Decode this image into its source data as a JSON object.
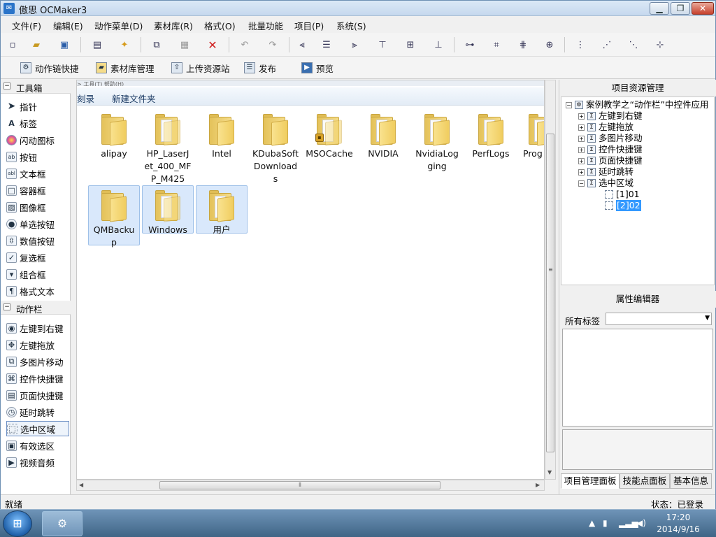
{
  "window": {
    "title": "傲思 OCMaker3",
    "min_label": "▁",
    "max_label": "❐",
    "close_label": "✕"
  },
  "menu": [
    "文件(F)",
    "编辑(E)",
    "动作菜单(D)",
    "素材库(R)",
    "格式(O)",
    "批量功能",
    "项目(P)",
    "系统(S)"
  ],
  "toolbar2": [
    "动作链快捷",
    "素材库管理",
    "上传资源站",
    "发布",
    "预览"
  ],
  "left": {
    "cat_tools": "工具箱",
    "tools": [
      "指针",
      "标签",
      "闪动图标",
      "按钮",
      "文本框",
      "容器框",
      "图像框",
      "单选按钮",
      "数值按钮",
      "复选框",
      "组合框",
      "格式文本"
    ],
    "cat_actions": "动作栏",
    "actions": [
      "左键到右键",
      "左键拖放",
      "多图片移动",
      "控件快捷键",
      "页面快捷键",
      "延时跳转",
      "选中区域",
      "有效选区",
      "视频音频"
    ]
  },
  "center": {
    "top_strip": "> 工具(T)    帮助(H)",
    "addr_burn": "刻录",
    "addr_newfolder": "新建文件夹",
    "folders": [
      {
        "name": "alipay"
      },
      {
        "name": "HP_LaserJet_400_MFP_M425"
      },
      {
        "name": "Intel"
      },
      {
        "name": "KDubaSoftDownloads"
      },
      {
        "name": "MSOCache"
      },
      {
        "name": "NVIDIA"
      },
      {
        "name": "NvidiaLogging"
      },
      {
        "name": "PerfLogs"
      },
      {
        "name": "Prog Fil"
      },
      {
        "name": "QMBackup"
      },
      {
        "name": "Windows"
      },
      {
        "name": "用户"
      }
    ]
  },
  "right": {
    "project_header": "项目资源管理",
    "tree_root": "案例教学之“动作栏”中控件应用",
    "tree_children": [
      "左键到右键",
      "左键拖放",
      "多图片移动",
      "控件快捷键",
      "页面快捷键",
      "延时跳转",
      "选中区域"
    ],
    "tree_leaves": [
      "[1]01",
      "[2]02"
    ],
    "prop_header": "属性编辑器",
    "prop_label": "所有标签",
    "tabs": [
      "项目管理面板",
      "技能点面板",
      "基本信息"
    ]
  },
  "status": {
    "left": "就绪",
    "right": "状态：已登录"
  },
  "taskbar": {
    "time": "17:20",
    "date": "2014/9/16"
  }
}
